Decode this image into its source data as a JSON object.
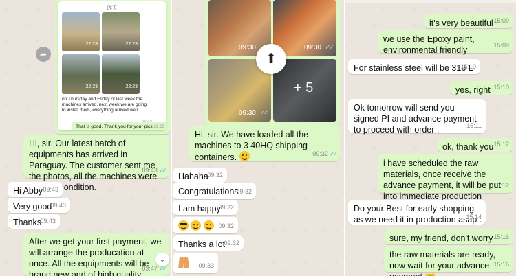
{
  "panel1": {
    "nested_date": "昨天",
    "photo_times": [
      "22:23",
      "22:23",
      "22:23",
      "22:23"
    ],
    "nested_text": "on Thursday and Friday of last week the machines arrived, next week we are going to install them, everything arrived well",
    "nested_time": "22:27",
    "nested_reply": "That is good. Thank you for your pics",
    "nested_reply_time": "22:28",
    "msg_latest": "Hi, sir. Our latest batch of equipments has arrived in Paraguay. The customer sent me the photos, all the machines were in good condition.",
    "msg_latest_time": "09:43",
    "in_msgs": [
      {
        "text": "Hi Abby",
        "time": "09:43"
      },
      {
        "text": "Very good",
        "time": "09:43"
      },
      {
        "text": "Thanks",
        "time": "09:43"
      }
    ],
    "msg_payment": "After we get your first payment, we will arrange the producation at once. All the equipments will be brand new and of high quality.",
    "msg_payment_time": "09:47"
  },
  "panel2": {
    "photo_times": [
      "09:30",
      "09:30",
      "09:30"
    ],
    "more_count": "+ 5",
    "msg_loaded": "Hi, sir. We have loaded all the machines to 3 40HQ shipping containers.",
    "msg_loaded_time": "09:32",
    "in_msgs": [
      {
        "text": "Hahaha",
        "time": "09:32"
      },
      {
        "text": "Congratulations",
        "time": "09:32"
      },
      {
        "text": "I am happy",
        "time": "09:32"
      },
      {
        "text": "",
        "time": "09:32"
      },
      {
        "text": "Thanks a lot",
        "time": "09:32"
      },
      {
        "text": "",
        "time": "09:33"
      }
    ]
  },
  "panel3": {
    "msgs": [
      {
        "dir": "out",
        "text": "it's very beautiful",
        "time": "15:09"
      },
      {
        "dir": "out",
        "text": "we use the Epoxy paint, environmental friendly",
        "time": "15:09"
      },
      {
        "dir": "in",
        "text": "For stainless steel will be 316 L",
        "time": "15:10"
      },
      {
        "dir": "out",
        "text": "yes, right",
        "time": "15:10"
      },
      {
        "dir": "in",
        "text": "Ok tomorrow will send you signed PI and advance payment to proceed with order .",
        "time": "15:11"
      },
      {
        "dir": "out",
        "text": "ok, thank you",
        "time": "15:12"
      },
      {
        "dir": "out",
        "text": "i have scheduled the raw materials, once receive the advance payment, it will be put into immediate production",
        "time": "15:12"
      },
      {
        "dir": "in",
        "text": "Do your Best for early shopping as we need it in production asap .",
        "time": "15:14"
      },
      {
        "dir": "out",
        "text": "sure, my friend, don't worry",
        "time": "15:16"
      },
      {
        "dir": "out",
        "text": "the raw materials are ready, now wait for your advance payment",
        "time": "15:16"
      }
    ]
  },
  "colors": {
    "outgoing": "#dcf8c6",
    "incoming": "#ffffff",
    "read_ticks": "#4fb6ec",
    "background": "#ece5dd"
  }
}
